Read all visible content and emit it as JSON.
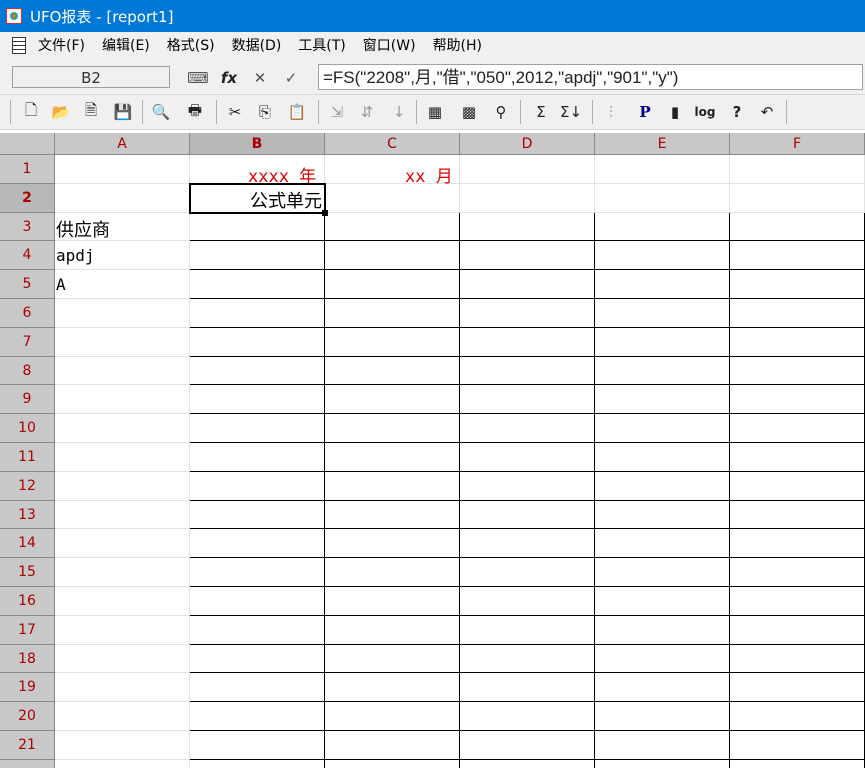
{
  "window": {
    "title": "UFO报表 - [report1]"
  },
  "menu": [
    "文件(F)",
    "编辑(E)",
    "格式(S)",
    "数据(D)",
    "工具(T)",
    "窗口(W)",
    "帮助(H)"
  ],
  "formula_bar": {
    "cell_ref": "B2",
    "fx_label": "fx",
    "cancel_glyph": "✕",
    "accept_glyph": "✓",
    "formula": "=FS(\"2208\",月,\"借\",\"050\",2012,\"apdj\",\"901\",\"y\")"
  },
  "toolbar": {
    "buttons": [
      {
        "icon": "new-document-icon",
        "glyph": "🗋"
      },
      {
        "icon": "open-folder-icon",
        "glyph": "📂"
      },
      {
        "icon": "document-icon",
        "glyph": "🗎"
      },
      {
        "icon": "save-icon",
        "glyph": "💾"
      },
      {
        "icon": "print-preview-icon",
        "glyph": "🔍"
      },
      {
        "icon": "print-icon",
        "glyph": "🖶"
      },
      {
        "icon": "cut-icon",
        "glyph": "✂"
      },
      {
        "icon": "copy-icon",
        "glyph": "⎘"
      },
      {
        "icon": "paste-icon",
        "glyph": "📋"
      },
      {
        "icon": "insert-row-icon",
        "glyph": "⇲"
      },
      {
        "icon": "insert-column-icon",
        "glyph": "⇵"
      },
      {
        "icon": "sort-icon",
        "glyph": "↓"
      },
      {
        "icon": "format-table-icon",
        "glyph": "▦"
      },
      {
        "icon": "grid-icon",
        "glyph": "▩"
      },
      {
        "icon": "find-icon",
        "glyph": "⚲"
      },
      {
        "icon": "sum-icon",
        "glyph": "Σ"
      },
      {
        "icon": "sum-down-icon",
        "glyph": "Σ↓"
      },
      {
        "icon": "chart-icon",
        "glyph": "⫶"
      },
      {
        "icon": "p-icon",
        "glyph": "P"
      },
      {
        "icon": "page-icon",
        "glyph": "▮"
      },
      {
        "icon": "log-icon",
        "glyph": "log"
      },
      {
        "icon": "help-pointer-icon",
        "glyph": "?"
      },
      {
        "icon": "undo-icon",
        "glyph": "↶"
      }
    ]
  },
  "sheet": {
    "columns": [
      "A",
      "B",
      "C",
      "D",
      "E",
      "F"
    ],
    "rows": [
      "1",
      "2",
      "3",
      "4",
      "5",
      "6",
      "7",
      "8",
      "9",
      "10",
      "11",
      "12",
      "13",
      "14",
      "15",
      "16",
      "17",
      "18",
      "19",
      "20",
      "21"
    ],
    "active_column": "B",
    "active_row": "2",
    "cells": {
      "B1": "xxxx 年",
      "C1": "xx 月",
      "B2": "公式单元",
      "A3": "供应商",
      "A4": "apdj",
      "A5": "A"
    },
    "colors": {
      "header_text": "#a00000",
      "red_text": "#e00000"
    }
  }
}
